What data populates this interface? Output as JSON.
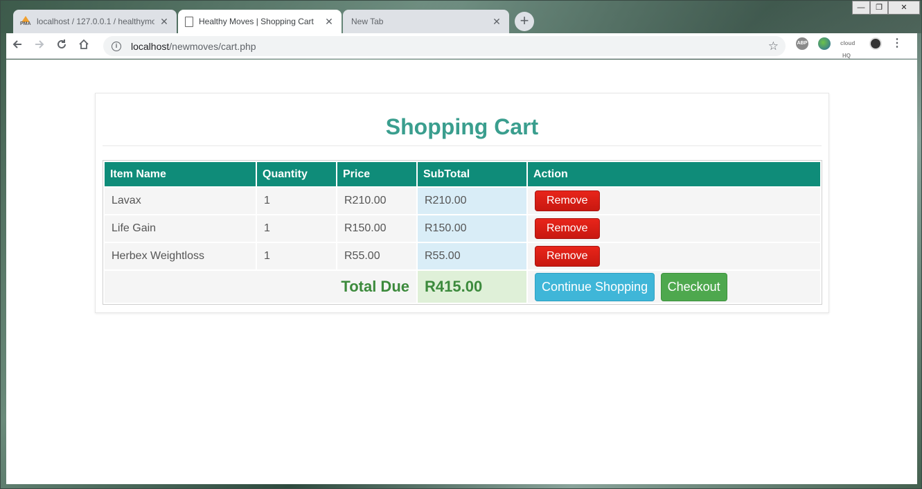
{
  "browser": {
    "tabs": [
      {
        "title": "localhost / 127.0.0.1 / healthymo",
        "favicon": "pma-icon",
        "active": false
      },
      {
        "title": "Healthy Moves | Shopping Cart",
        "favicon": "document-icon",
        "active": true
      },
      {
        "title": "New Tab",
        "favicon": "",
        "active": false
      }
    ],
    "new_tab": "+",
    "close_glyph": "✕",
    "window_controls": {
      "minimize": "—",
      "maximize": "❐",
      "close": "✕"
    },
    "address": {
      "host": "localhost",
      "path": "/newmoves/cart.php"
    },
    "extensions": {
      "abp": "ABP",
      "cloud": "cloud HQ"
    }
  },
  "page": {
    "title": "Shopping Cart",
    "columns": [
      "Item Name",
      "Quantity",
      "Price",
      "SubTotal",
      "Action"
    ],
    "rows": [
      {
        "name": "Lavax",
        "qty": "1",
        "price": "R210.00",
        "subtotal": "R210.00",
        "action": "Remove"
      },
      {
        "name": "Life Gain",
        "qty": "1",
        "price": "R150.00",
        "subtotal": "R150.00",
        "action": "Remove"
      },
      {
        "name": "Herbex Weightloss",
        "qty": "1",
        "price": "R55.00",
        "subtotal": "R55.00",
        "action": "Remove"
      }
    ],
    "total_label": "Total Due",
    "total_value": "R415.00",
    "continue_label": "Continue Shopping",
    "checkout_label": "Checkout"
  },
  "colors": {
    "header_bg": "#0f8c79",
    "title_color": "#3a9e8e",
    "remove_btn": "#d81e15",
    "continue_btn": "#3fb6d8",
    "checkout_btn": "#4ea84e",
    "total_text": "#3c8a3c"
  }
}
